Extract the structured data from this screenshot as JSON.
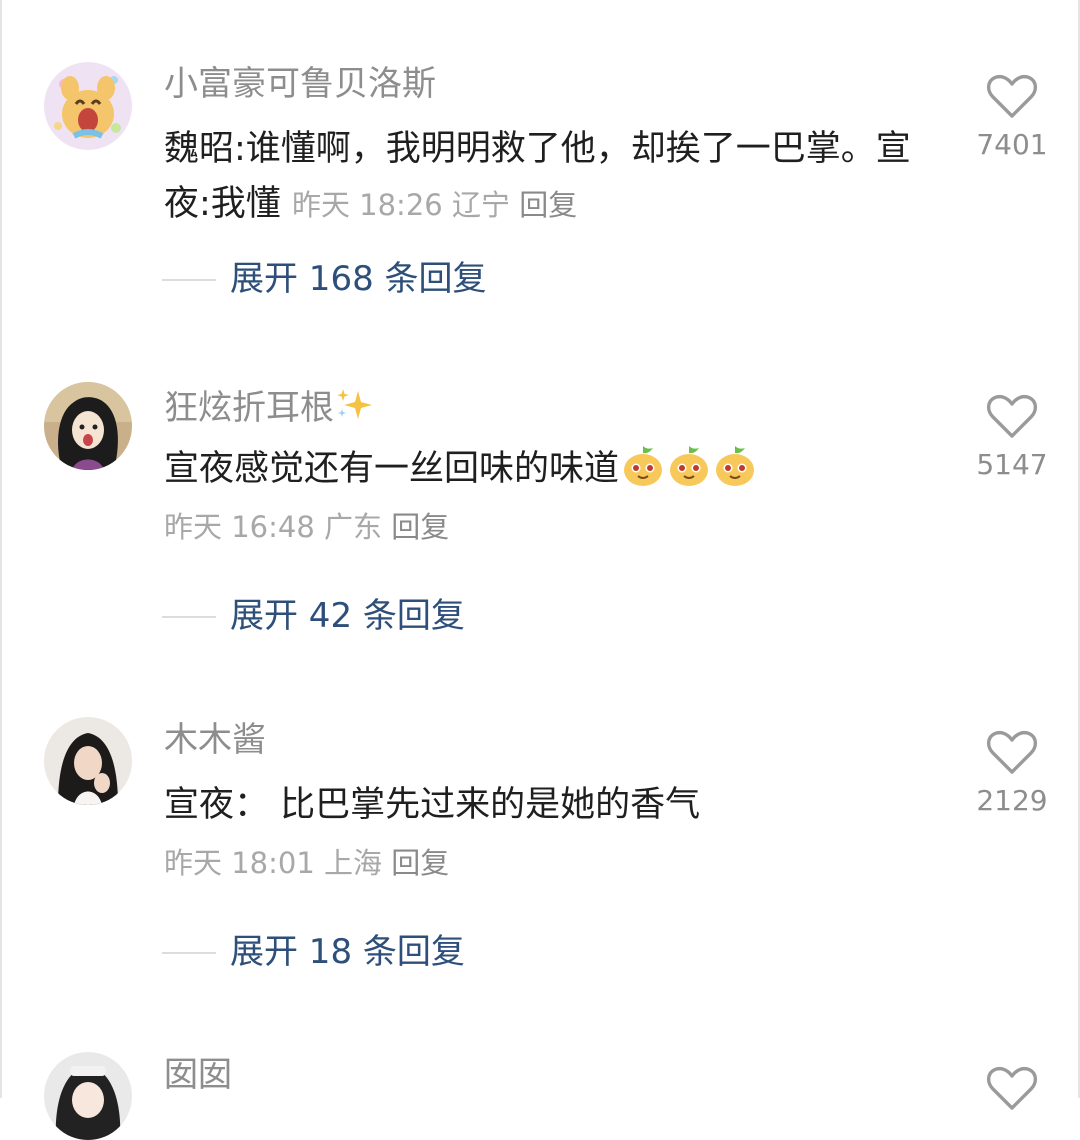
{
  "comments": [
    {
      "username": "小富豪可鲁贝洛斯",
      "text": "魏昭:谁懂啊，我明明救了他，却挨了一巴掌。宣夜:我懂",
      "time": "昨天 18:26",
      "location": "辽宁",
      "reply_label": "回复",
      "likes": "7401",
      "expand_label": "展开 168 条回复",
      "avatar_icon": "cartoon-bear-icon"
    },
    {
      "username": "狂炫折耳根",
      "username_emoji": "sparkles-icon",
      "text": "宣夜感觉还有一丝回味的味道",
      "text_emojis": [
        "mango-smile-icon",
        "mango-smile-icon",
        "mango-smile-icon"
      ],
      "time": "昨天 16:48",
      "location": "广东",
      "reply_label": "回复",
      "likes": "5147",
      "expand_label": "展开 42 条回复",
      "avatar_icon": "anime-girl-icon"
    },
    {
      "username": "木木酱",
      "text": "宣夜： 比巴掌先过来的是她的香气",
      "time": "昨天 18:01",
      "location": "上海",
      "reply_label": "回复",
      "likes": "2129",
      "expand_label": "展开 18 条回复",
      "avatar_icon": "person-photo-icon"
    },
    {
      "username": "囡囡",
      "avatar_icon": "anime-girl-icon"
    }
  ],
  "colors": {
    "username": "#8d8d8d",
    "text": "#1f1f1f",
    "meta": "#a8a8a8",
    "expand": "#2d4f7a",
    "like_icon": "#9a9a9a"
  }
}
